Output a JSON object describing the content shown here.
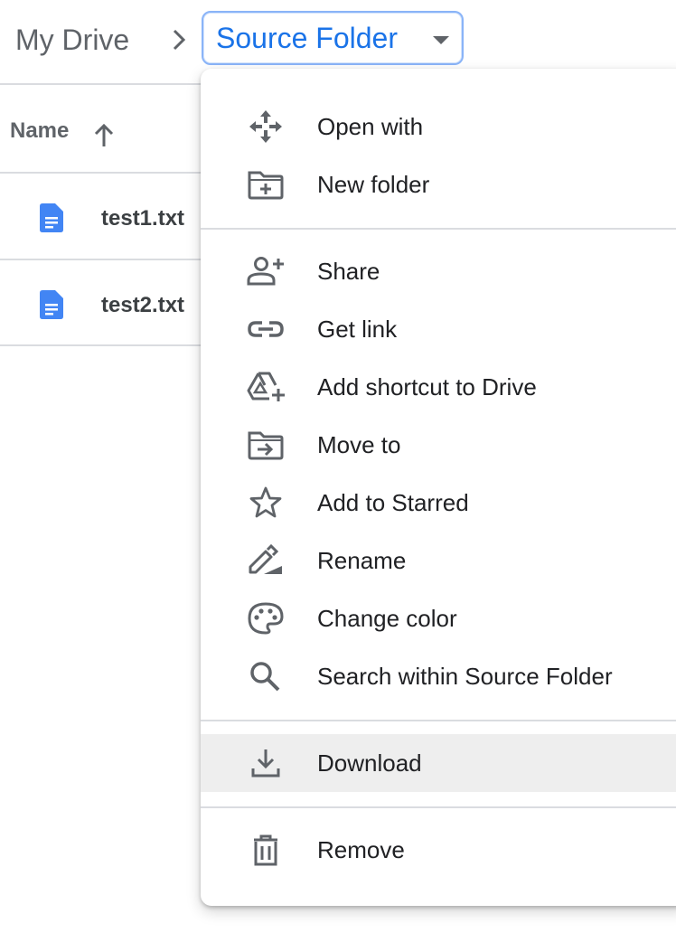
{
  "breadcrumb": {
    "root": "My Drive",
    "current": "Source Folder"
  },
  "list": {
    "column_name": "Name",
    "sort": "ascending",
    "files": [
      {
        "name": "test1.txt",
        "icon": "doc-icon"
      },
      {
        "name": "test2.txt",
        "icon": "doc-icon"
      }
    ]
  },
  "menu": {
    "items": [
      {
        "label": "Open with",
        "icon": "open-with-icon"
      },
      {
        "label": "New folder",
        "icon": "new-folder-icon"
      },
      {
        "label": "Share",
        "icon": "share-icon"
      },
      {
        "label": "Get link",
        "icon": "link-icon"
      },
      {
        "label": "Add shortcut to Drive",
        "icon": "add-shortcut-icon"
      },
      {
        "label": "Move to",
        "icon": "move-to-icon"
      },
      {
        "label": "Add to Starred",
        "icon": "star-icon"
      },
      {
        "label": "Rename",
        "icon": "rename-icon"
      },
      {
        "label": "Change color",
        "icon": "palette-icon"
      },
      {
        "label": "Search within Source Folder",
        "icon": "search-icon"
      },
      {
        "label": "Download",
        "icon": "download-icon"
      },
      {
        "label": "Remove",
        "icon": "trash-icon"
      }
    ],
    "highlighted": "Download"
  },
  "colors": {
    "accent": "#1a73e8",
    "icon_gray": "#5f6368",
    "file_icon_blue": "#4285f4",
    "divider": "#dadce0",
    "hover": "#eeeeee"
  }
}
